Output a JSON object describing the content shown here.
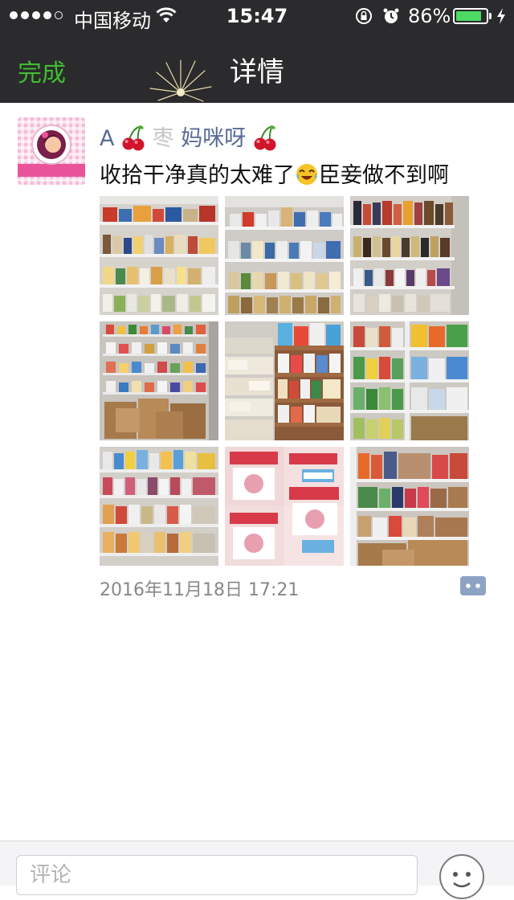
{
  "status_bar": {
    "carrier": "中国移动",
    "time": "15:47",
    "battery_percent_label": "86%",
    "battery_level": 0.86,
    "signal_bars_filled": 4,
    "signal_bars_total": 5,
    "icons": [
      "wifi-icon",
      "rotation-lock-icon",
      "alarm-icon",
      "battery-icon",
      "charging-icon"
    ]
  },
  "nav": {
    "done_label": "完成",
    "title": "详情"
  },
  "post": {
    "nickname_prefix": "A",
    "nickname_middle": "枣",
    "nickname_suffix": "妈咪呀",
    "text_part1": "收拾干净真的太难了",
    "text_part2": "臣妾做不到啊",
    "photo_count": 9,
    "timestamp": "2016年11月18日 17:21"
  },
  "bottom_bar": {
    "comment_placeholder": "评论"
  },
  "colors": {
    "header_bg": "#2b2b2d",
    "accent_green": "#3fbe2f",
    "nickname_blue": "#576b95",
    "battery_green": "#4cd964"
  }
}
